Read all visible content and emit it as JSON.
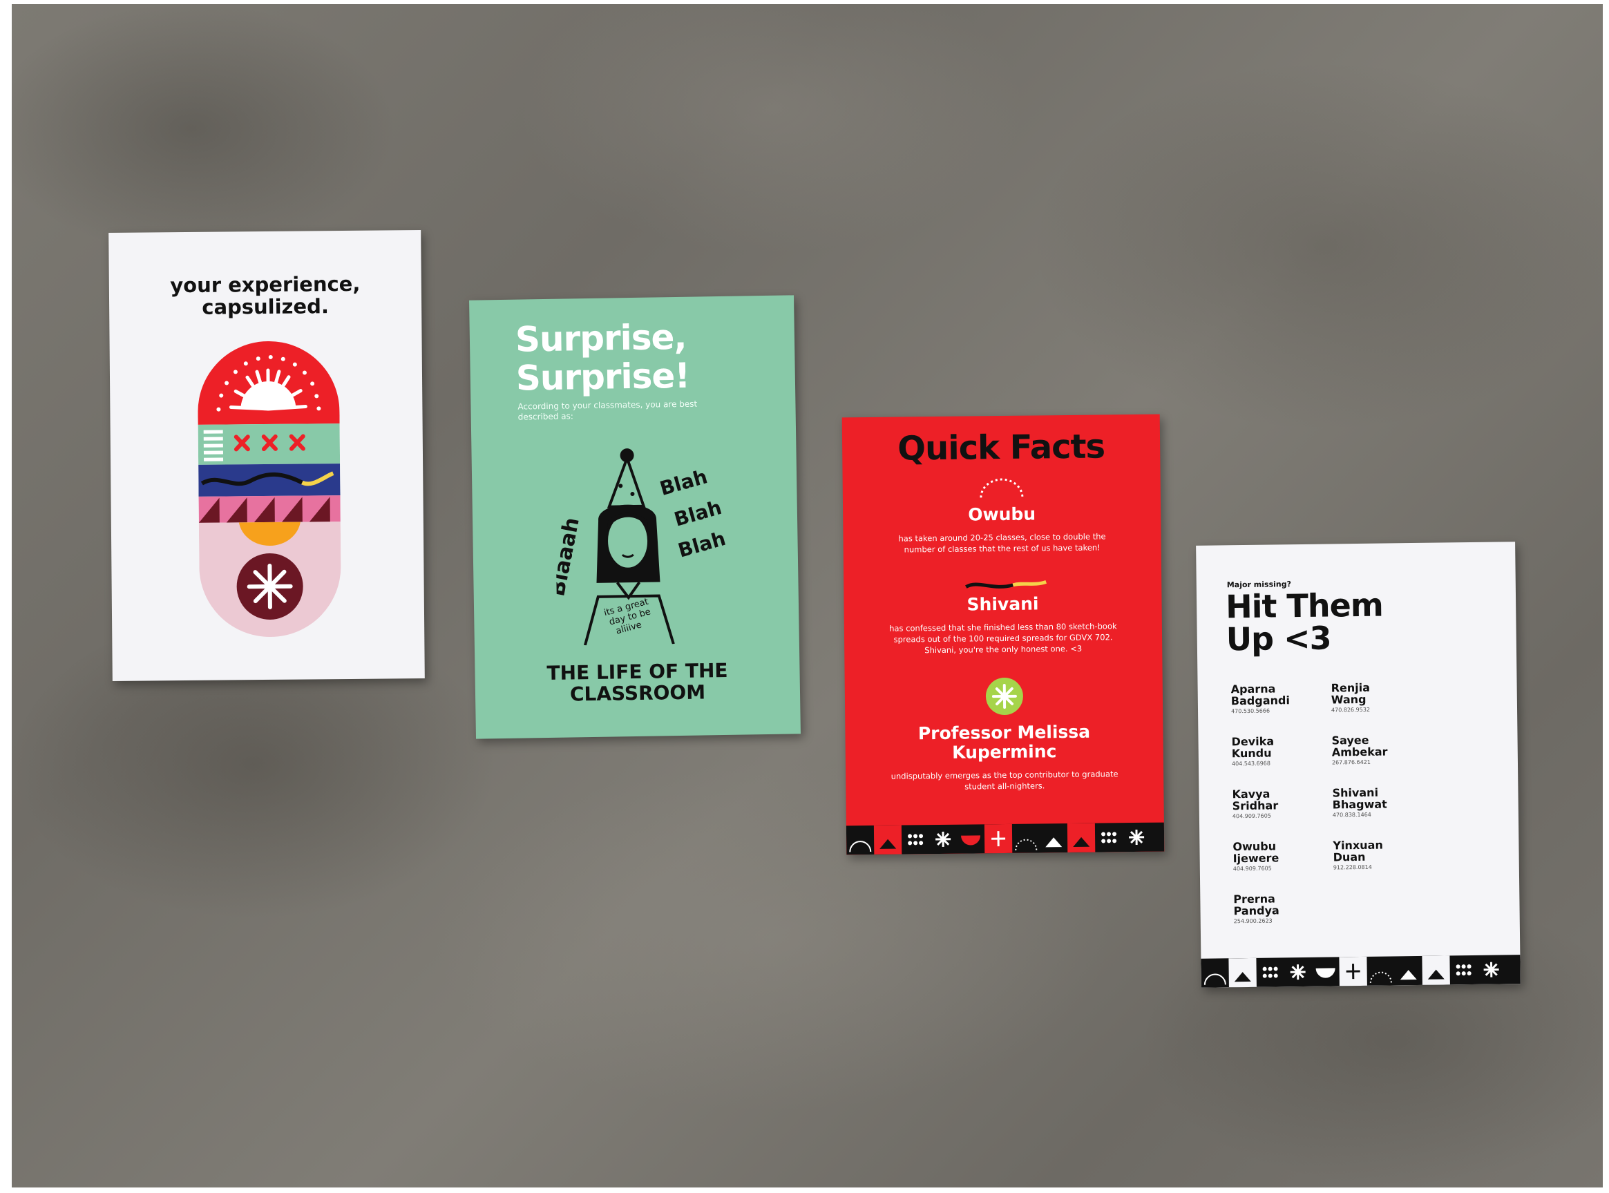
{
  "card1": {
    "title": "your experience,\ncapsulized."
  },
  "card2": {
    "heading": "Surprise,\nSurprise!",
    "subtitle": "According to your classmates, you are best described as:",
    "doodle_left": "Blaaah",
    "doodle_right": [
      "Blah",
      "Blah",
      "Blah"
    ],
    "doodle_caption": [
      "its a great",
      "day to be",
      "aliiive"
    ],
    "award": "THE LIFE OF THE\nCLASSROOM"
  },
  "card3": {
    "heading": "Quick Facts",
    "facts": [
      {
        "name": "Owubu",
        "desc": "has taken around 20-25 classes, close to double the number of classes that the rest of us have taken!"
      },
      {
        "name": "Shivani",
        "desc": "has confessed that she finished less than 80 sketch-book spreads out of the 100 required spreads for GDVX 702. Shivani, you're the only honest one. <3"
      },
      {
        "name": "Professor Melissa\nKuperminc",
        "desc": "undisputably emerges as the top contributor to graduate student all-nighters."
      }
    ]
  },
  "card4": {
    "kicker": "Major missing?",
    "heading": "Hit Them\nUp <3",
    "contacts": [
      {
        "name": "Aparna\nBadgandi",
        "phone": "470.530.5666"
      },
      {
        "name": "Renjia\nWang",
        "phone": "470.826.9532"
      },
      {
        "name": "Devika\nKundu",
        "phone": "404.543.6968"
      },
      {
        "name": "Sayee\nAmbekar",
        "phone": "267.876.6421"
      },
      {
        "name": "Kavya\nSridhar",
        "phone": "404.909.7605"
      },
      {
        "name": "Shivani\nBhagwat",
        "phone": "470.838.1464"
      },
      {
        "name": "Owubu\nIjewere",
        "phone": "404.909.7605"
      },
      {
        "name": "Yinxuan\nDuan",
        "phone": "912.228.0814"
      },
      {
        "name": "Prerna\nPandya",
        "phone": "254.900.2623"
      }
    ]
  },
  "colors": {
    "red": "#ed2027",
    "mint": "#88c9a8",
    "navy": "#2a3a8c",
    "pink": "#e7729f",
    "orange": "#f7a11c",
    "maroon": "#6b1724",
    "lightpink": "#ecc9d3",
    "black": "#111111"
  }
}
